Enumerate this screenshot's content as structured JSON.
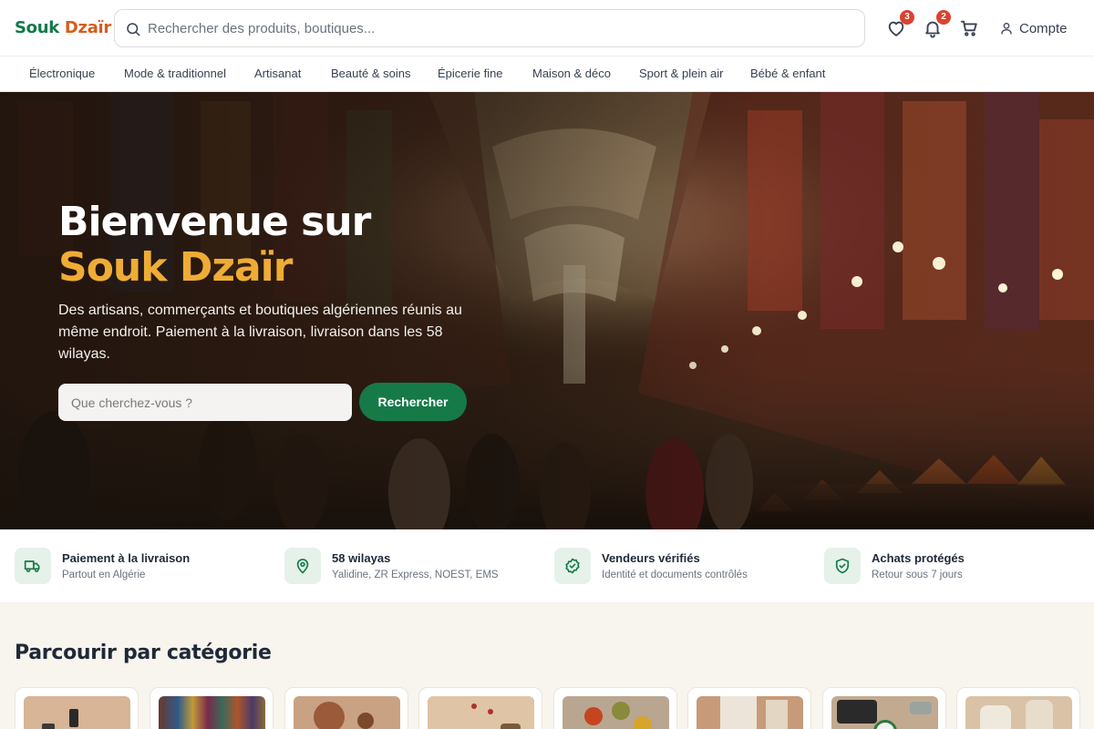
{
  "brand": {
    "part1": "Souk",
    "part2": "Dzaïr"
  },
  "search": {
    "placeholder": "Rechercher des produits, boutiques..."
  },
  "header": {
    "wishlist_count": "3",
    "notifications_count": "2",
    "account_label": "Compte"
  },
  "nav": {
    "items": [
      {
        "label": "Électronique"
      },
      {
        "label": "Mode & traditionnel"
      },
      {
        "label": "Artisanat"
      },
      {
        "label": "Beauté & soins"
      },
      {
        "label": "Épicerie fine"
      },
      {
        "label": "Maison & déco"
      },
      {
        "label": "Sport & plein air"
      },
      {
        "label": "Bébé & enfant"
      }
    ]
  },
  "hero": {
    "title_line1": "Bienvenue sur",
    "title_line2": "Souk Dzaïr",
    "subtitle": "Des artisans, commerçants et boutiques algériennes réunis au même endroit. Paiement à la livraison, livraison dans les 58 wilayas.",
    "search_placeholder": "Que cherchez-vous ?",
    "search_button": "Rechercher"
  },
  "features": [
    {
      "icon": "truck-icon",
      "title": "Paiement à la livraison",
      "subtitle": "Partout en Algérie"
    },
    {
      "icon": "map-pin-icon",
      "title": "58 wilayas",
      "subtitle": "Yalidine, ZR Express, NOEST, EMS"
    },
    {
      "icon": "badge-check-icon",
      "title": "Vendeurs vérifiés",
      "subtitle": "Identité et documents contrôlés"
    },
    {
      "icon": "shield-check-icon",
      "title": "Achats protégés",
      "subtitle": "Retour sous 7 jours"
    }
  ],
  "categories": {
    "heading": "Parcourir par catégorie"
  },
  "colors": {
    "brand_green": "#127a48",
    "brand_orange": "#d35f20",
    "hero_accent": "#efac35",
    "button_green": "#157a47",
    "badge_red": "#d9432f"
  }
}
